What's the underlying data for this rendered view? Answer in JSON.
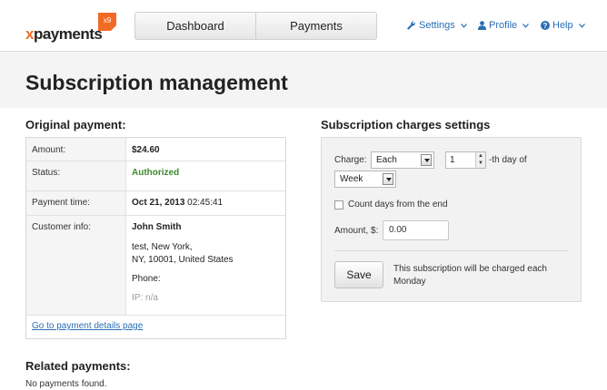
{
  "header": {
    "logo_text_x": "x",
    "logo_text_rest": "payments",
    "logo_badge_text": "x9",
    "nav_tabs": [
      {
        "label": "Dashboard"
      },
      {
        "label": "Payments"
      }
    ],
    "menus": {
      "settings": "Settings",
      "profile": "Profile",
      "help": "Help"
    }
  },
  "page": {
    "title": "Subscription management"
  },
  "original_payment": {
    "title": "Original payment:",
    "rows": {
      "amount_label": "Amount:",
      "amount_value": "$24.60",
      "status_label": "Status:",
      "status_value": "Authorized",
      "time_label": "Payment time:",
      "time_date": "Oct 21, 2013",
      "time_clock": "02:45:41",
      "customer_label": "Customer info:",
      "customer_name": "John Smith",
      "customer_address1": "test, New York,",
      "customer_address2": "NY, 10001, United States",
      "customer_phone": "Phone:",
      "customer_ip": "IP: n/a"
    },
    "details_link": "Go to payment details page"
  },
  "subscription_settings": {
    "title": "Subscription charges settings",
    "charge_label": "Charge:",
    "charge_mode": "Each",
    "day_value": "1",
    "day_suffix": "-th day of",
    "period": "Week",
    "count_from_end_label": "Count days from the end",
    "count_from_end_checked": false,
    "amount_label": "Amount, $:",
    "amount_value": "0.00",
    "save_label": "Save",
    "note": "This subscription will be charged each Monday"
  },
  "related": {
    "title": "Related payments:",
    "empty_text": "No payments found."
  },
  "colors": {
    "accent_orange": "#f26b24",
    "link_blue": "#2a6fb5",
    "status_green": "#3c8a2e"
  }
}
